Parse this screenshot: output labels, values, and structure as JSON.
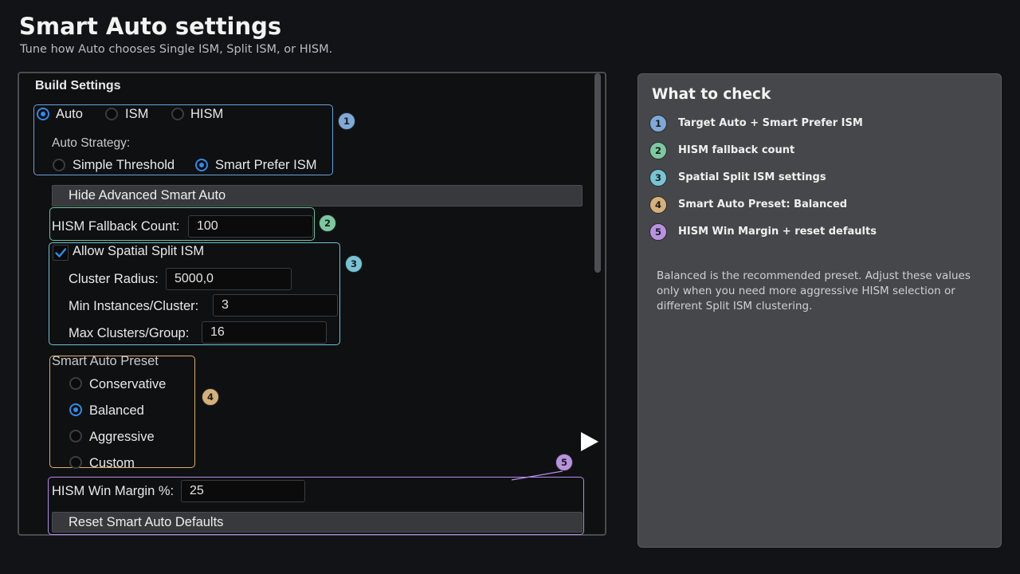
{
  "header": {
    "title": "Smart Auto settings",
    "subtitle": "Tune how Auto chooses Single ISM, Split ISM, or HISM."
  },
  "settings": {
    "section_title": "Build Settings",
    "build_target": {
      "options": [
        "Auto",
        "ISM",
        "HISM"
      ],
      "selected": "Auto"
    },
    "auto_strategy": {
      "label": "Auto Strategy:",
      "options": [
        "Simple Threshold",
        "Smart Prefer ISM"
      ],
      "selected": "Smart Prefer ISM"
    },
    "advanced_toggle_label": "Hide Advanced Smart Auto",
    "hism_fallback": {
      "label": "HISM Fallback Count:",
      "value": "100"
    },
    "spatial_split": {
      "checkbox_label": "Allow Spatial Split ISM",
      "checked": true,
      "cluster_radius": {
        "label": "Cluster Radius:",
        "value": "5000,0"
      },
      "min_instances": {
        "label": "Min Instances/Cluster:",
        "value": "3"
      },
      "max_clusters": {
        "label": "Max Clusters/Group:",
        "value": "16"
      }
    },
    "preset": {
      "label": "Smart Auto Preset",
      "options": [
        "Conservative",
        "Balanced",
        "Aggressive",
        "Custom"
      ],
      "selected": "Balanced"
    },
    "hism_win_margin": {
      "label": "HISM Win Margin %:",
      "value": "25"
    },
    "reset_label": "Reset Smart Auto Defaults"
  },
  "badges": [
    "1",
    "2",
    "3",
    "4",
    "5"
  ],
  "colors": {
    "badge_1": "#7ea9d8",
    "badge_2": "#7cc9a0",
    "badge_3": "#76c4d6",
    "badge_4": "#d5b07a",
    "badge_5": "#b892e0",
    "accent": "#2e8ce8"
  },
  "checklist": {
    "title": "What to check",
    "items": [
      "Target Auto + Smart Prefer ISM",
      "HISM fallback count",
      "Spatial Split ISM settings",
      "Smart Auto Preset: Balanced",
      "HISM Win Margin + reset defaults"
    ],
    "note": "Balanced is the recommended preset. Adjust these values only when you need more aggressive HISM selection or different Split ISM clustering."
  },
  "icons": {
    "cursor": "play-triangle-icon",
    "check": "checkmark-icon"
  }
}
